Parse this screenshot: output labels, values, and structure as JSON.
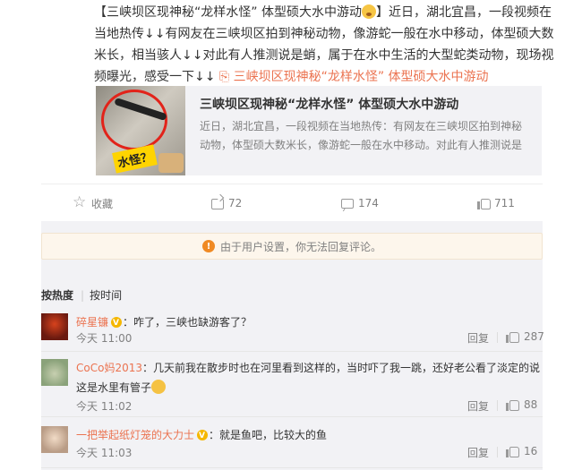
{
  "post": {
    "text_part1": "【三峡坝区现神秘“龙样水怪” 体型硕大水中游动",
    "text_part2": "】近日，湖北宜昌，一段视频在当地热传↓↓有网友在三峡坝区拍到神秘动物，像游蛇一般在水中移动，体型硕大数米长，相当骇人↓↓对此有人推测说是蛸，属于在水中生活的大型蛇类动物，现场视频曝光，感受一下↓↓",
    "link_icon": "link-icon",
    "link_text": "三峡坝区现神秘“龙样水怪” 体型硕大水中游动"
  },
  "share_card": {
    "thumb_tag": "水怪？",
    "title": "三峡坝区现神秘“龙样水怪” 体型硕大水中游动",
    "description": "近日，湖北宜昌，一段视频在当地热传：有网友在三峡坝区拍到神秘动物，体型硕大数米长，像游蛇一般在水中移动。对此有人推测说是"
  },
  "actions": {
    "favorite": "收藏",
    "forward": "72",
    "comment": "174",
    "like": "711"
  },
  "notice": {
    "icon": "warning-icon",
    "text": "由于用户设置，你无法回复评论。"
  },
  "sort": {
    "hot": "按热度",
    "time": "按时间"
  },
  "comments": [
    {
      "user": "碎星镰",
      "text": "：咋了，三峡也缺游客了？",
      "time": "今天 11:00",
      "reply": "回复",
      "likes": "287"
    },
    {
      "user": "CoCo妈2013",
      "text": "：几天前我在散步时也在河里看到这样的，当时吓了我一跳，还好老公看了淡定的说这是水里有管子",
      "time": "今天 11:02",
      "reply": "回复",
      "likes": "88"
    },
    {
      "user": "一把举起纸灯笼的大力士",
      "text": "：就是鱼吧，比较大的鱼",
      "time": "今天 11:03",
      "reply": "回复",
      "likes": "16"
    }
  ],
  "colors": {
    "link": "#eb7350",
    "muted": "#808080",
    "text": "#333333"
  }
}
